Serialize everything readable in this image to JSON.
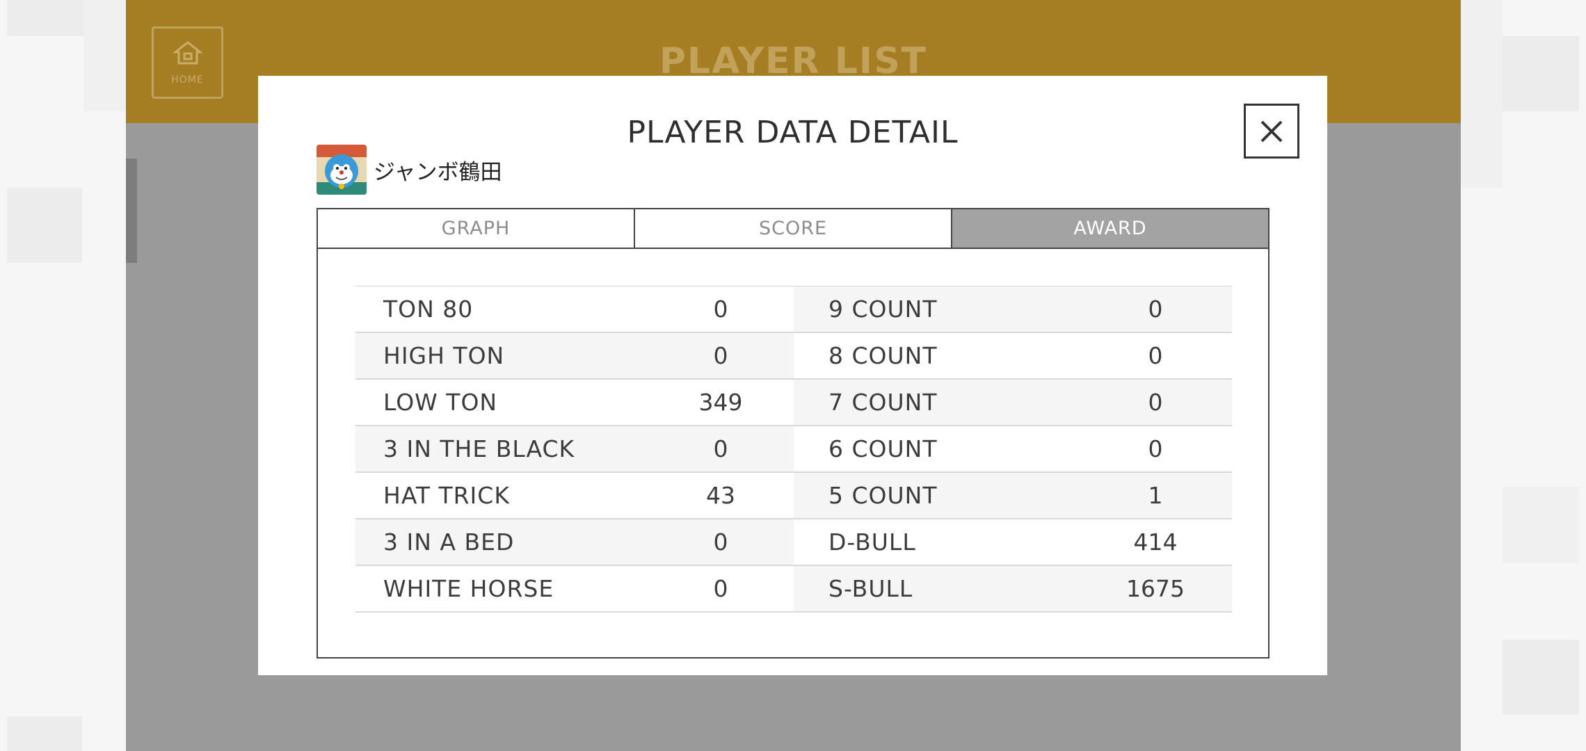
{
  "app": {
    "title": "PLAYER LIST",
    "home_label": "HOME"
  },
  "modal": {
    "title": "PLAYER DATA DETAIL",
    "close_icon": "close-icon"
  },
  "player": {
    "name": "ジャンボ鶴田",
    "avatar_icon": "avatar-cat-icon"
  },
  "tabs": [
    {
      "label": "GRAPH",
      "active": false
    },
    {
      "label": "SCORE",
      "active": false
    },
    {
      "label": "AWARD",
      "active": true
    }
  ],
  "awards": [
    {
      "left_label": "TON 80",
      "left_value": "0",
      "right_label": "9 COUNT",
      "right_value": "0"
    },
    {
      "left_label": "HIGH TON",
      "left_value": "0",
      "right_label": "8 COUNT",
      "right_value": "0"
    },
    {
      "left_label": "LOW TON",
      "left_value": "349",
      "right_label": "7 COUNT",
      "right_value": "0"
    },
    {
      "left_label": "3 IN THE BLACK",
      "left_value": "0",
      "right_label": "6 COUNT",
      "right_value": "0"
    },
    {
      "left_label": "HAT TRICK",
      "left_value": "43",
      "right_label": "5 COUNT",
      "right_value": "1"
    },
    {
      "left_label": "3 IN A BED",
      "left_value": "0",
      "right_label": "D-BULL",
      "right_value": "414"
    },
    {
      "left_label": "WHITE HORSE",
      "left_value": "0",
      "right_label": "S-BULL",
      "right_value": "1675"
    }
  ],
  "colors": {
    "header": "#a57e23",
    "overlay": "#9a9a9a",
    "active_tab": "#a3a3a3"
  }
}
